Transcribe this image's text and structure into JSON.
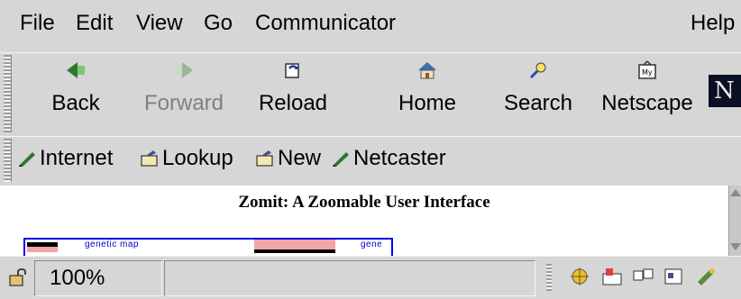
{
  "menubar": {
    "items": [
      "File",
      "Edit",
      "View",
      "Go",
      "Communicator"
    ],
    "help": "Help"
  },
  "toolbar": {
    "buttons": [
      {
        "label": "Back",
        "icon": "back-arrow-icon",
        "enabled": true
      },
      {
        "label": "Forward",
        "icon": "forward-arrow-icon",
        "enabled": false
      },
      {
        "label": "Reload",
        "icon": "reload-icon",
        "enabled": true
      },
      {
        "label": "Home",
        "icon": "home-icon",
        "enabled": true
      },
      {
        "label": "Search",
        "icon": "search-icon",
        "enabled": true
      },
      {
        "label": "Netscape",
        "icon": "my-netscape-icon",
        "enabled": true
      }
    ],
    "logo": "N"
  },
  "personalbar": {
    "items": [
      {
        "label": "Internet",
        "icon": "bookmark-pencil-icon"
      },
      {
        "label": "Lookup",
        "icon": "folder-icon"
      },
      {
        "label": "New",
        "icon": "folder-icon"
      },
      {
        "label": "Netcaster",
        "icon": "bookmark-pencil-icon"
      }
    ]
  },
  "content": {
    "title": "Zomit: A Zoomable User Interface",
    "strip": {
      "label_1": "genetic map",
      "label_2": "gene"
    }
  },
  "statusbar": {
    "zoom": "100%",
    "status_text": "",
    "component_icons": [
      "navigator-icon",
      "mail-icon",
      "discussions-icon",
      "composer-icon",
      "conference-icon"
    ]
  },
  "colors": {
    "chrome": "#d6d6d6",
    "link_blue": "#0000ee",
    "pink": "#f4a6a6",
    "logo_bg": "#0b0f24"
  }
}
